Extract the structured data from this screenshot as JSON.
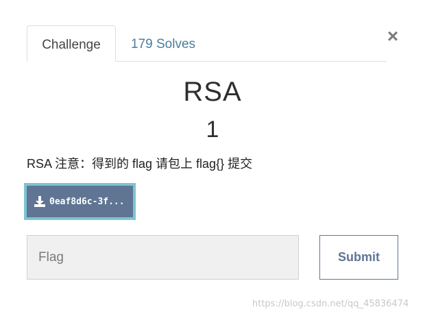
{
  "tabs": {
    "challenge_label": "Challenge",
    "solves_label": "179 Solves"
  },
  "close_label": "×",
  "challenge": {
    "name": "RSA",
    "points": "1",
    "description": "RSA 注意：得到的 flag 请包上 flag{} 提交",
    "file_label": "0eaf8d6c-3f..."
  },
  "form": {
    "flag_placeholder": "Flag",
    "flag_value": "",
    "submit_label": "Submit"
  },
  "watermark": "https://blog.csdn.net/qq_45836474",
  "icons": {
    "download": "download-icon",
    "close": "close-icon"
  },
  "colors": {
    "file_button_bg": "#5f7593",
    "file_button_border": "#7cc4d4",
    "tab_link": "#4a7d9e"
  }
}
